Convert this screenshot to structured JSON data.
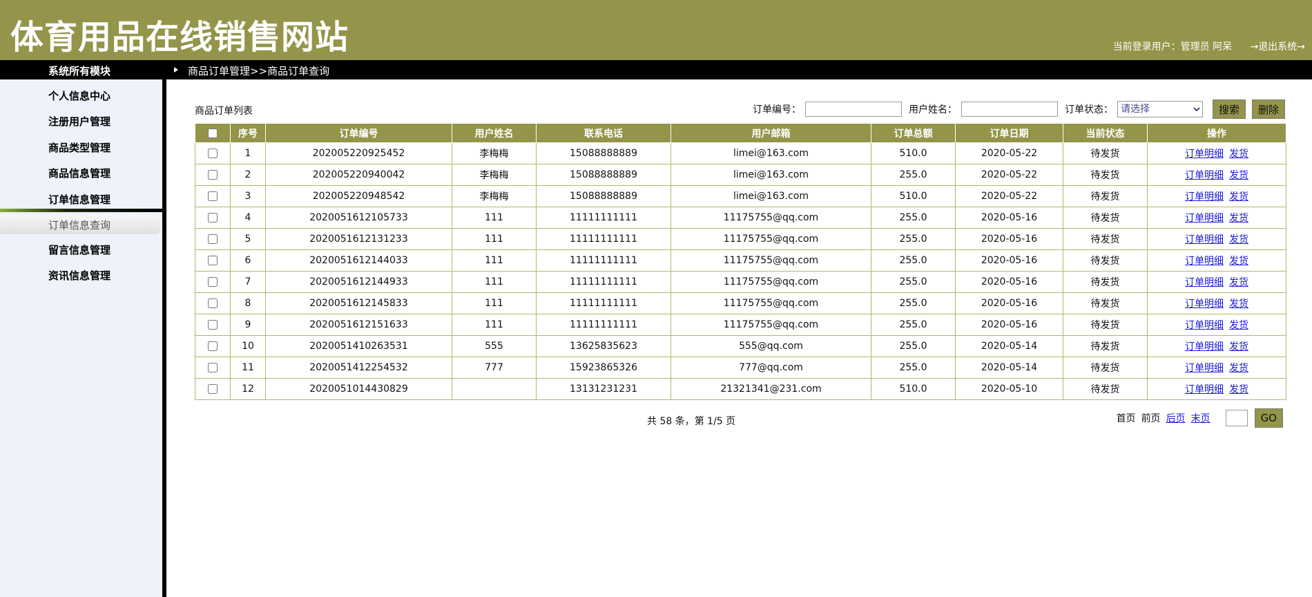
{
  "header": {
    "site_title": "体育用品在线销售网站",
    "current_user_label": "当前登录用户：管理员 阿呆",
    "logout": "→退出系统→"
  },
  "topbar": {
    "module_title": "系统所有模块",
    "breadcrumb": "商品订单管理>>商品订单查询"
  },
  "sidebar": {
    "items": [
      "个人信息中心",
      "注册用户管理",
      "商品类型管理",
      "商品信息管理",
      "订单信息管理"
    ],
    "active_sub": "订单信息查询",
    "items_after": [
      "留言信息管理",
      "资讯信息管理"
    ]
  },
  "list_title": "商品订单列表",
  "search": {
    "order_no_label": "订单编号：",
    "order_no_value": "",
    "username_label": "用户姓名：",
    "username_value": "",
    "status_label": "订单状态：",
    "status_selected": "请选择",
    "search_button": "搜索",
    "delete_button": "删除"
  },
  "table": {
    "columns": [
      "序号",
      "订单编号",
      "用户姓名",
      "联系电话",
      "用户邮箱",
      "订单总额",
      "订单日期",
      "当前状态",
      "操作"
    ],
    "action_detail": "订单明细",
    "action_ship": "发货",
    "rows": [
      {
        "idx": "1",
        "order_no": "202005220925452",
        "name": "李梅梅",
        "phone": "15088888889",
        "email": "limei@163.com",
        "total": "510.0",
        "date": "2020-05-22",
        "status": "待发货"
      },
      {
        "idx": "2",
        "order_no": "202005220940042",
        "name": "李梅梅",
        "phone": "15088888889",
        "email": "limei@163.com",
        "total": "255.0",
        "date": "2020-05-22",
        "status": "待发货"
      },
      {
        "idx": "3",
        "order_no": "202005220948542",
        "name": "李梅梅",
        "phone": "15088888889",
        "email": "limei@163.com",
        "total": "510.0",
        "date": "2020-05-22",
        "status": "待发货"
      },
      {
        "idx": "4",
        "order_no": "2020051612105733",
        "name": "111",
        "phone": "11111111111",
        "email": "11175755@qq.com",
        "total": "255.0",
        "date": "2020-05-16",
        "status": "待发货"
      },
      {
        "idx": "5",
        "order_no": "2020051612131233",
        "name": "111",
        "phone": "11111111111",
        "email": "11175755@qq.com",
        "total": "255.0",
        "date": "2020-05-16",
        "status": "待发货"
      },
      {
        "idx": "6",
        "order_no": "2020051612144033",
        "name": "111",
        "phone": "11111111111",
        "email": "11175755@qq.com",
        "total": "255.0",
        "date": "2020-05-16",
        "status": "待发货"
      },
      {
        "idx": "7",
        "order_no": "2020051612144933",
        "name": "111",
        "phone": "11111111111",
        "email": "11175755@qq.com",
        "total": "255.0",
        "date": "2020-05-16",
        "status": "待发货"
      },
      {
        "idx": "8",
        "order_no": "2020051612145833",
        "name": "111",
        "phone": "11111111111",
        "email": "11175755@qq.com",
        "total": "255.0",
        "date": "2020-05-16",
        "status": "待发货"
      },
      {
        "idx": "9",
        "order_no": "2020051612151633",
        "name": "111",
        "phone": "11111111111",
        "email": "11175755@qq.com",
        "total": "255.0",
        "date": "2020-05-16",
        "status": "待发货"
      },
      {
        "idx": "10",
        "order_no": "2020051410263531",
        "name": "555",
        "phone": "13625835623",
        "email": "555@qq.com",
        "total": "255.0",
        "date": "2020-05-14",
        "status": "待发货"
      },
      {
        "idx": "11",
        "order_no": "2020051412254532",
        "name": "777",
        "phone": "15923865326",
        "email": "777@qq.com",
        "total": "255.0",
        "date": "2020-05-14",
        "status": "待发货"
      },
      {
        "idx": "12",
        "order_no": "2020051014430829",
        "name": "",
        "phone": "13131231231",
        "email": "21321341@231.com",
        "total": "510.0",
        "date": "2020-05-10",
        "status": "待发货"
      }
    ]
  },
  "pagination": {
    "info": "共 58 条，第 1/5 页",
    "first": "首页",
    "prev": "前页",
    "next": "后页",
    "last": "末页",
    "page_input": "",
    "go": "GO"
  },
  "colors": {
    "header_bg": "#94944a",
    "topbar_bg": "#000000",
    "sidebar_bg": "#eef2fb",
    "link": "#1a1ad6"
  }
}
